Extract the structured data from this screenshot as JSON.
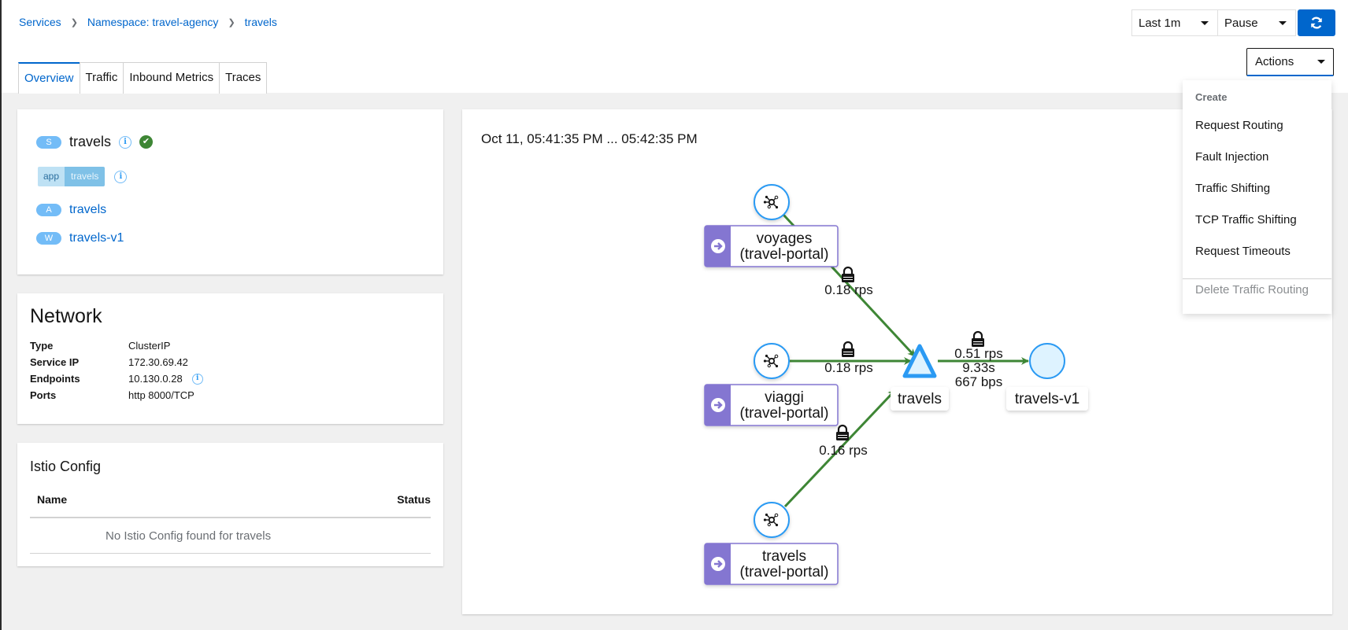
{
  "breadcrumb": [
    {
      "label": "Services"
    },
    {
      "label": "Namespace: travel-agency"
    },
    {
      "label": "travels"
    }
  ],
  "tabs": [
    {
      "label": "Overview",
      "active": true
    },
    {
      "label": "Traffic",
      "active": false
    },
    {
      "label": "Inbound Metrics",
      "active": false
    },
    {
      "label": "Traces",
      "active": false
    }
  ],
  "toolbar": {
    "duration": "Last 1m",
    "refresh_interval": "Pause",
    "refresh_icon": "sync-icon",
    "actions_label": "Actions"
  },
  "actions_menu": {
    "group_label": "Create",
    "items": [
      "Request Routing",
      "Fault Injection",
      "Traffic Shifting",
      "TCP Traffic Shifting",
      "Request Timeouts"
    ],
    "delete_label": "Delete Traffic Routing"
  },
  "service_card": {
    "service_badge": "S",
    "service_name": "travels",
    "status": "healthy",
    "label_key": "app",
    "label_value": "travels",
    "app_badge": "A",
    "app_link": "travels",
    "workload_badge": "W",
    "workload_link": "travels-v1"
  },
  "network": {
    "title": "Network",
    "rows": [
      {
        "key": "Type",
        "value": "ClusterIP"
      },
      {
        "key": "Service IP",
        "value": "172.30.69.42"
      },
      {
        "key": "Endpoints",
        "value": "10.130.0.28"
      },
      {
        "key": "Ports",
        "value": "http 8000/TCP"
      }
    ]
  },
  "istio_config": {
    "title": "Istio Config",
    "col_name": "Name",
    "col_status": "Status",
    "empty_message": "No Istio Config found for travels"
  },
  "graph": {
    "time_range": "Oct 11, 05:41:35 PM ... 05:42:35 PM",
    "nodes": [
      {
        "id": "voyages",
        "label_line1": "voyages",
        "label_line2": "(travel-portal)",
        "type": "workload",
        "icon": "gateway-icon"
      },
      {
        "id": "viaggi",
        "label_line1": "viaggi",
        "label_line2": "(travel-portal)",
        "type": "workload",
        "icon": "gateway-icon"
      },
      {
        "id": "travels-portal",
        "label_line1": "travels",
        "label_line2": "(travel-portal)",
        "type": "workload",
        "icon": "gateway-icon"
      },
      {
        "id": "travels-svc",
        "label": "travels",
        "type": "service"
      },
      {
        "id": "travels-v1",
        "label": "travels-v1",
        "type": "workload"
      }
    ],
    "edges": [
      {
        "from": "voyages",
        "to": "travels-svc",
        "rate": "0.18 rps",
        "mtls": true
      },
      {
        "from": "viaggi",
        "to": "travels-svc",
        "rate": "0.18 rps",
        "mtls": true
      },
      {
        "from": "travels-portal",
        "to": "travels-svc",
        "rate": "0.16 rps",
        "mtls": true
      },
      {
        "from": "travels-svc",
        "to": "travels-v1",
        "rate": "0.51 rps",
        "response_time": "9.33s",
        "throughput": "667 bps",
        "mtls": true
      }
    ]
  },
  "colors": {
    "accent": "#0066cc",
    "edge_healthy": "#3e8635",
    "node_border": "#2b9af3",
    "node_fill": "#def3ff",
    "namespace_box": "#8476d1"
  }
}
